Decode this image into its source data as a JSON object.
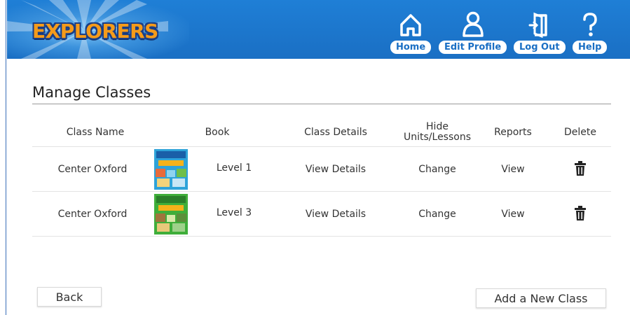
{
  "header": {
    "logo_text": "EXPLORERS",
    "nav": [
      {
        "label": "Home",
        "icon": "home-icon"
      },
      {
        "label": "Edit Profile",
        "icon": "person-icon"
      },
      {
        "label": "Log Out",
        "icon": "logout-icon"
      },
      {
        "label": "Help",
        "icon": "help-icon"
      }
    ],
    "colors": {
      "bar": "#1a6fc4",
      "logo": "#f59b1a"
    }
  },
  "page": {
    "title": "Manage Classes"
  },
  "table": {
    "columns": {
      "class_name": "Class Name",
      "book": "Book",
      "class_details": "Class Details",
      "hide_line1": "Hide",
      "hide_line2": "Units/Lessons",
      "reports": "Reports",
      "delete": "Delete"
    },
    "rows": [
      {
        "class_name": "Center Oxford",
        "level": "Level 1",
        "details": "View Details",
        "hide": "Change",
        "reports": "View",
        "cover_color": "#2ea3d9"
      },
      {
        "class_name": "Center Oxford",
        "level": "Level 3",
        "details": "View Details",
        "hide": "Change",
        "reports": "View",
        "cover_color": "#3fae3a"
      }
    ]
  },
  "buttons": {
    "back": "Back",
    "add_class": "Add a New Class"
  }
}
